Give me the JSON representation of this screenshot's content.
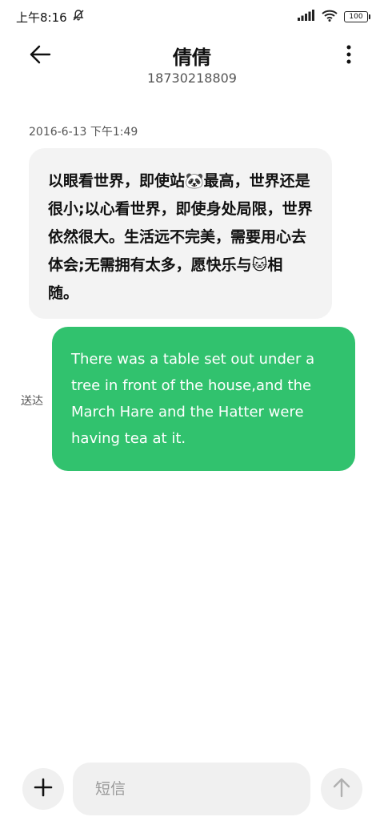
{
  "status_bar": {
    "time": "上午8:16",
    "battery": "100"
  },
  "header": {
    "contact_name": "倩倩",
    "contact_number": "18730218809"
  },
  "conversation": {
    "timestamp": "2016-6-13 下午1:49",
    "incoming_message": "以眼看世界，即使站🐼最高，世界还是很小;以心看世界，即使身处局限，世界依然很大。生活远不完美，需要用心去体会;无需拥有太多，愿快乐与🐱相随。",
    "outgoing_message": "There was a table set out under a tree in front of the house,and the March Hare and the Hatter were having tea at it.",
    "delivery_status": "送达"
  },
  "input_bar": {
    "placeholder": "短信"
  },
  "colors": {
    "outgoing_bubble": "#31c26e",
    "incoming_bubble": "#f3f3f3"
  },
  "icons": {
    "back": "arrow-left-icon",
    "more": "more-vertical-icon",
    "add": "plus-icon",
    "send": "arrow-up-icon",
    "mute": "bell-off-icon",
    "signal": "signal-icon",
    "wifi": "wifi-icon"
  }
}
